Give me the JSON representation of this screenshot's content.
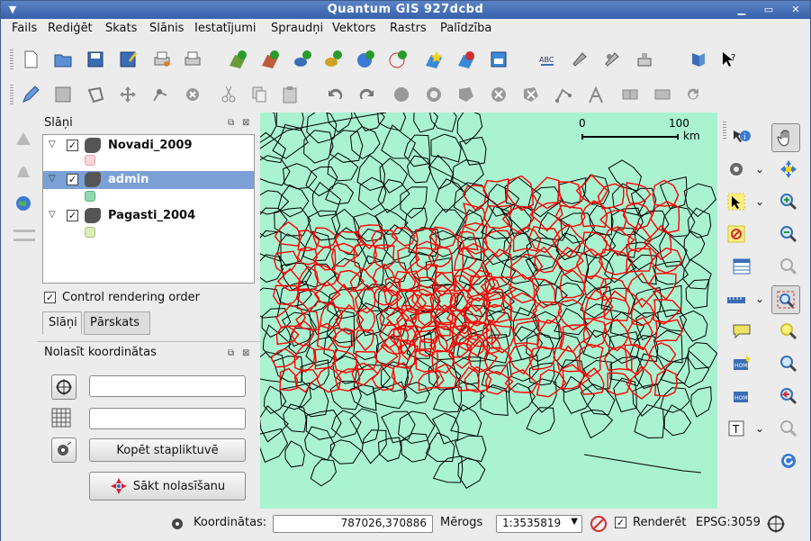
{
  "window": {
    "title": "Quantum GIS 927dcbd"
  },
  "menu": [
    "Fails",
    "Rediģēt",
    "Skats",
    "Slānis",
    "Iestatījumi",
    "Spraudņi",
    "Vektors",
    "Rastrs",
    "Palīdzība"
  ],
  "layers_panel": {
    "title": "Slāņi",
    "layers": [
      {
        "name": "Novadi_2009",
        "checked": true,
        "selected": false,
        "swatch_color": "#f7d6dc"
      },
      {
        "name": "admin",
        "checked": true,
        "selected": true,
        "swatch_color": "#8fd9b2"
      },
      {
        "name": "Pagasti_2004",
        "checked": true,
        "selected": false,
        "swatch_color": "#dcebb8"
      }
    ],
    "control_rendering_label": "Control rendering order",
    "control_rendering_checked": true,
    "tabs": [
      "Slāņi",
      "Pārskats"
    ]
  },
  "coord_panel": {
    "title": "Nolasīt koordinātas",
    "field1": "",
    "field2": "",
    "copy_button": "Kopēt stapliktuvē",
    "start_button": "Sākt nolasīšanu"
  },
  "scalebar": {
    "start": "0",
    "end": "100",
    "unit": "km"
  },
  "status": {
    "coords_label": "Koordinātas:",
    "coords_value": "787026,370886",
    "scale_label": "Mērogs",
    "scale_value": "1:3535819",
    "render_label": "Renderēt",
    "render_checked": true,
    "crs": "EPSG:3059"
  },
  "colors": {
    "map_bg": "#aaf3d0",
    "red_lines": "#ff0000",
    "selected_row": "#7aa0d6"
  }
}
